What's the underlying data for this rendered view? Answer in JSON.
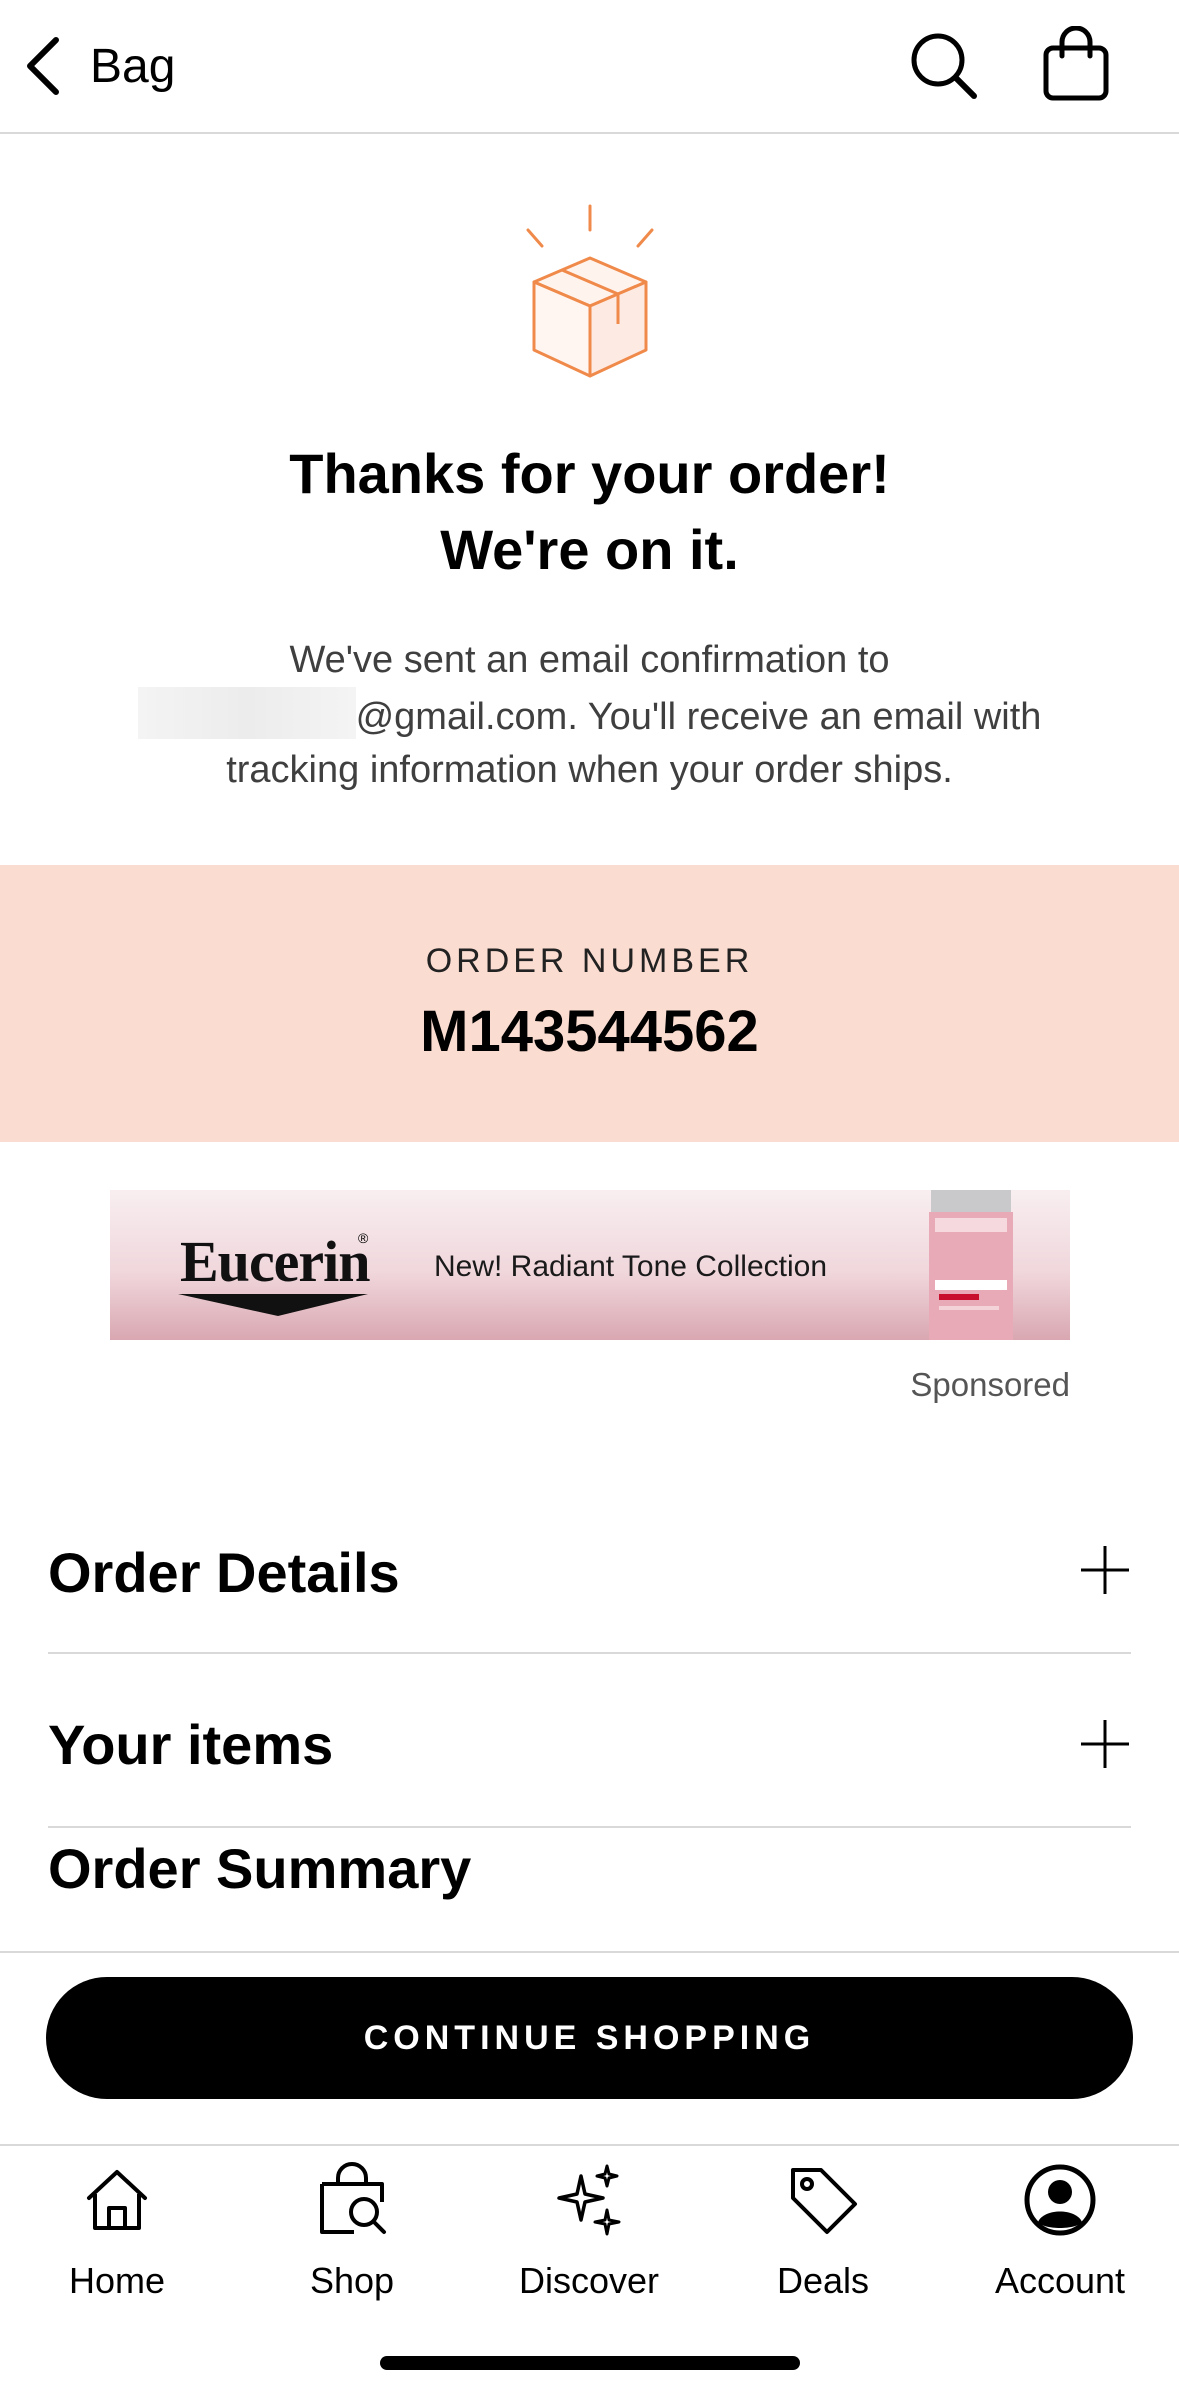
{
  "header": {
    "back_label": "Bag",
    "back_icon": "chevron-left-icon",
    "search_icon": "search-icon",
    "bag_icon": "shopping-bag-icon"
  },
  "confirmation": {
    "icon": "package-box-icon",
    "title_line1": "Thanks for your order!",
    "title_line2": "We're on it.",
    "message_line1": "We've sent an email confirmation to",
    "email_suffix": "@gmail.com. You'll receive an email with",
    "message_line3": "tracking information when your order ships."
  },
  "order": {
    "label": "ORDER NUMBER",
    "number": "M143544562"
  },
  "ad": {
    "brand": "Eucerin",
    "tagline": "New! Radiant Tone Collection",
    "sponsored_label": "Sponsored"
  },
  "accordions": {
    "order_details": "Order Details",
    "your_items": "Your items",
    "order_summary": "Order Summary"
  },
  "cta": {
    "label": "CONTINUE SHOPPING"
  },
  "tabbar": {
    "home": "Home",
    "shop": "Shop",
    "discover": "Discover",
    "deals": "Deals",
    "account": "Account"
  },
  "colors": {
    "order_band": "#fadcd1",
    "accent_orange": "#f08a4b",
    "cta_bg": "#000000"
  }
}
